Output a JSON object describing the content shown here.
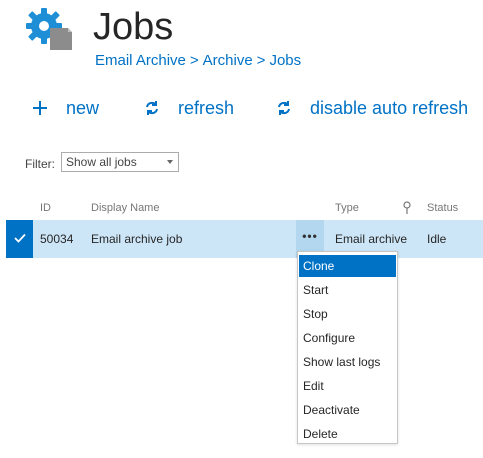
{
  "header": {
    "title": "Jobs",
    "icon": "gear-with-document-icon"
  },
  "breadcrumb": [
    "Email Archive",
    "Archive",
    "Jobs"
  ],
  "breadcrumb_separator": ">",
  "commands": {
    "new": {
      "label": "new",
      "icon": "plus-icon"
    },
    "refresh": {
      "label": "refresh",
      "icon": "refresh-icon"
    },
    "disable_auto_refresh": {
      "label": "disable auto refresh",
      "icon": "refresh-icon"
    }
  },
  "filter": {
    "label": "Filter:",
    "value": "Show all jobs"
  },
  "table": {
    "columns": {
      "id": "ID",
      "display_name": "Display Name",
      "type": "Type",
      "status": "Status"
    },
    "rows": [
      {
        "id": "50034",
        "display_name": "Email archive job",
        "type": "Email archive",
        "status": "Idle",
        "selected": true
      }
    ]
  },
  "row_menu": {
    "trigger": "•••",
    "items": [
      "Clone",
      "Start",
      "Stop",
      "Configure",
      "Show last logs",
      "Edit",
      "Deactivate",
      "Delete"
    ],
    "highlighted": "Clone"
  },
  "colors": {
    "accent": "#0072c6",
    "row_selected": "#cde6f7"
  }
}
